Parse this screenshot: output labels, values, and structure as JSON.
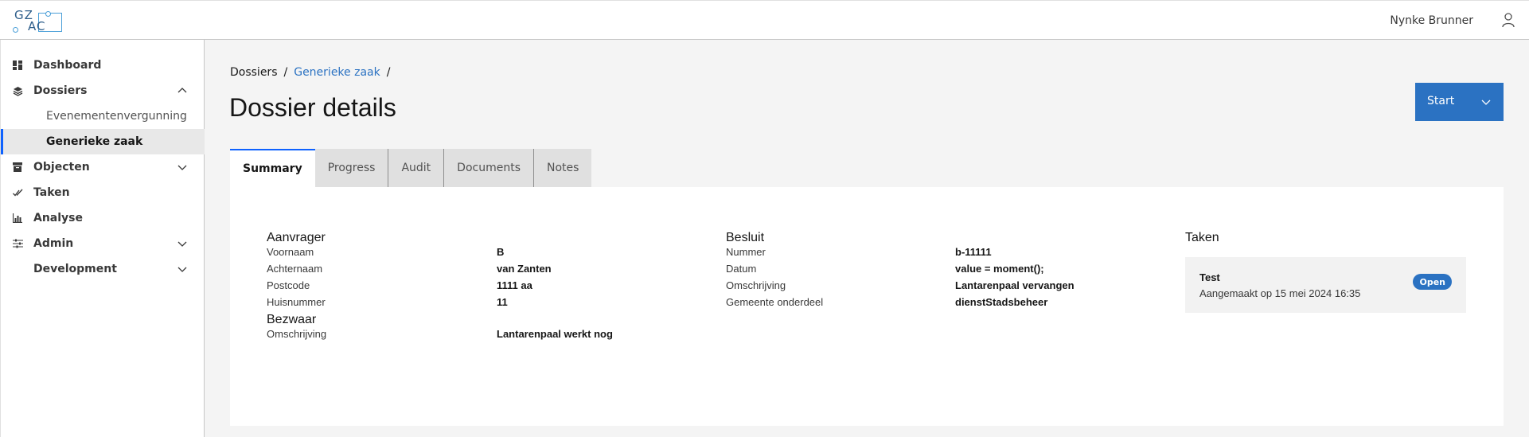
{
  "header": {
    "logo_line1": "GZ",
    "logo_line2": "AC",
    "user_name": "Nynke Brunner",
    "user_icon": "user-icon"
  },
  "sidebar": {
    "items": [
      {
        "label": "Dashboard",
        "icon": "dashboard-icon"
      },
      {
        "label": "Dossiers",
        "icon": "layers-icon",
        "expanded": true
      },
      {
        "label": "Evenementenvergunning"
      },
      {
        "label": "Generieke zaak",
        "active": true
      },
      {
        "label": "Objecten",
        "icon": "archive-icon"
      },
      {
        "label": "Taken",
        "icon": "checkmark-icon"
      },
      {
        "label": "Analyse",
        "icon": "bar-chart-icon"
      },
      {
        "label": "Admin",
        "icon": "settings-adjust-icon"
      },
      {
        "label": "Development"
      }
    ]
  },
  "breadcrumb": {
    "root": "Dossiers",
    "sep": "/",
    "link": "Generieke zaak"
  },
  "page": {
    "title": "Dossier details",
    "start_label": "Start"
  },
  "tabs": [
    "Summary",
    "Progress",
    "Audit",
    "Documents",
    "Notes"
  ],
  "summary": {
    "aanvrager": {
      "title": "Aanvrager",
      "fields": [
        {
          "label": "Voornaam",
          "value": "B"
        },
        {
          "label": "Achternaam",
          "value": "van Zanten"
        },
        {
          "label": "Postcode",
          "value": "1111 aa"
        },
        {
          "label": "Huisnummer",
          "value": "11"
        }
      ]
    },
    "bezwaar": {
      "title": "Bezwaar",
      "fields": [
        {
          "label": "Omschrijving",
          "value": "Lantarenpaal werkt nog"
        }
      ]
    },
    "besluit": {
      "title": "Besluit",
      "fields": [
        {
          "label": "Nummer",
          "value": "b-11111"
        },
        {
          "label": "Datum",
          "value": "value = moment();"
        },
        {
          "label": "Omschrijving",
          "value": "Lantarenpaal vervangen"
        },
        {
          "label": "Gemeente onderdeel",
          "value": "dienstStadsbeheer"
        }
      ]
    },
    "taken": {
      "title": "Taken",
      "task": {
        "name": "Test",
        "created": "Aangemaakt op 15 mei 2024 16:35",
        "status": "Open"
      }
    }
  },
  "colors": {
    "accent": "#0f62fe",
    "button": "#2b72c2",
    "badge": "#2b72c2"
  }
}
